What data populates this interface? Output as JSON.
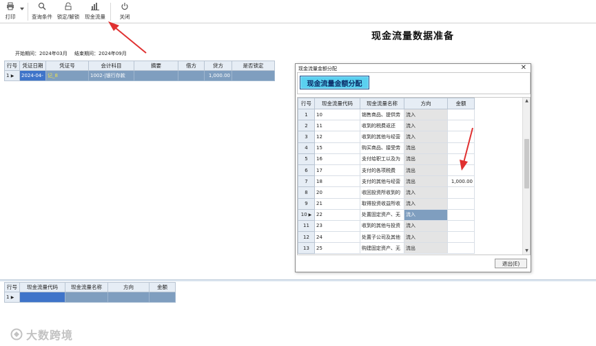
{
  "toolbar": {
    "buttons": [
      {
        "label": "打印",
        "icon": "printer-icon"
      },
      {
        "label": "查询条件",
        "icon": "search-icon"
      },
      {
        "label": "锁定/解锁",
        "icon": "lock-icon"
      },
      {
        "label": "现金流量",
        "icon": "chart-icon"
      },
      {
        "label": "关闭",
        "icon": "power-icon"
      }
    ]
  },
  "title": "现金流量数据准备",
  "period": {
    "start": "开始期间：2024年03月",
    "end": "结束期间：2024年09月"
  },
  "upper_grid": {
    "headers": [
      "行号",
      "凭证日期",
      "凭证号",
      "会计科目",
      "摘要",
      "借方",
      "贷方",
      "是否锁定"
    ],
    "rows": [
      {
        "row": "1",
        "date": "2024-04-",
        "voucher": "记_8",
        "account": "1002-|银行存款",
        "summary": "",
        "debit": "",
        "credit": "1,000.00",
        "locked": ""
      }
    ]
  },
  "dialog": {
    "title": "现金流量金额分配",
    "close": "✕",
    "tag": "现金流量金额分配",
    "headers": [
      "行号",
      "现金流量代码",
      "现金流量名称",
      "方向",
      "金额"
    ],
    "rows": [
      {
        "row": "1",
        "code": "10",
        "name": "销售商品、提供劳",
        "dir": "流入",
        "amount": ""
      },
      {
        "row": "2",
        "code": "11",
        "name": "收到的税费返还",
        "dir": "流入",
        "amount": ""
      },
      {
        "row": "3",
        "code": "12",
        "name": "收到的其他与经营",
        "dir": "流入",
        "amount": ""
      },
      {
        "row": "4",
        "code": "15",
        "name": "购买商品、接受劳",
        "dir": "流出",
        "amount": ""
      },
      {
        "row": "5",
        "code": "16",
        "name": "支付给职工以及为",
        "dir": "流出",
        "amount": ""
      },
      {
        "row": "6",
        "code": "17",
        "name": "支付的各项税费",
        "dir": "流出",
        "amount": ""
      },
      {
        "row": "7",
        "code": "18",
        "name": "支付的其他与经营",
        "dir": "流出",
        "amount": "1,000.00"
      },
      {
        "row": "8",
        "code": "20",
        "name": "收回投资所收到的",
        "dir": "流入",
        "amount": ""
      },
      {
        "row": "9",
        "code": "21",
        "name": "取得投资收益所收",
        "dir": "流入",
        "amount": ""
      },
      {
        "row": "10",
        "code": "22",
        "name": "处置固定资产、无",
        "dir": "流入",
        "amount": ""
      },
      {
        "row": "11",
        "code": "23",
        "name": "收到的其他与投资",
        "dir": "流入",
        "amount": ""
      },
      {
        "row": "12",
        "code": "24",
        "name": "处置子公司及其他",
        "dir": "流入",
        "amount": ""
      },
      {
        "row": "13",
        "code": "25",
        "name": "购建固定资产、无",
        "dir": "流出",
        "amount": ""
      }
    ],
    "exit_label": "退出(E)"
  },
  "lower_grid": {
    "headers": [
      "行号",
      "现金流量代码",
      "现金流量名称",
      "方向",
      "金额"
    ],
    "rows": [
      {
        "row": "1",
        "code": "",
        "name": "",
        "dir": "",
        "amount": ""
      }
    ]
  },
  "watermark": "大数跨境",
  "colors": {
    "selected_row": "#7f9ebf",
    "active_cell": "#3f74c9",
    "tag_bg": "#5ad0f0",
    "arrow": "#e03030"
  }
}
